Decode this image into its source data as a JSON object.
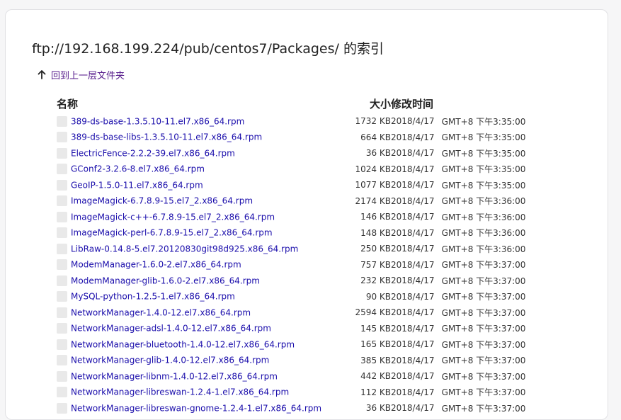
{
  "page": {
    "title": "ftp://192.168.199.224/pub/centos7/Packages/ 的索引",
    "up_label": "回到上一层文件夹"
  },
  "columns": {
    "name": "名称",
    "size": "大小",
    "modified": "修改时间"
  },
  "files": [
    {
      "name": "389-ds-base-1.3.5.10-11.el7.x86_64.rpm",
      "size": "1732 KB",
      "date": "2018/4/17",
      "time": "GMT+8 下午3:35:00"
    },
    {
      "name": "389-ds-base-libs-1.3.5.10-11.el7.x86_64.rpm",
      "size": "664 KB",
      "date": "2018/4/17",
      "time": "GMT+8 下午3:35:00"
    },
    {
      "name": "ElectricFence-2.2.2-39.el7.x86_64.rpm",
      "size": "36 KB",
      "date": "2018/4/17",
      "time": "GMT+8 下午3:35:00"
    },
    {
      "name": "GConf2-3.2.6-8.el7.x86_64.rpm",
      "size": "1024 KB",
      "date": "2018/4/17",
      "time": "GMT+8 下午3:35:00"
    },
    {
      "name": "GeoIP-1.5.0-11.el7.x86_64.rpm",
      "size": "1077 KB",
      "date": "2018/4/17",
      "time": "GMT+8 下午3:35:00"
    },
    {
      "name": "ImageMagick-6.7.8.9-15.el7_2.x86_64.rpm",
      "size": "2174 KB",
      "date": "2018/4/17",
      "time": "GMT+8 下午3:36:00"
    },
    {
      "name": "ImageMagick-c++-6.7.8.9-15.el7_2.x86_64.rpm",
      "size": "146 KB",
      "date": "2018/4/17",
      "time": "GMT+8 下午3:36:00"
    },
    {
      "name": "ImageMagick-perl-6.7.8.9-15.el7_2.x86_64.rpm",
      "size": "148 KB",
      "date": "2018/4/17",
      "time": "GMT+8 下午3:36:00"
    },
    {
      "name": "LibRaw-0.14.8-5.el7.20120830git98d925.x86_64.rpm",
      "size": "250 KB",
      "date": "2018/4/17",
      "time": "GMT+8 下午3:36:00"
    },
    {
      "name": "ModemManager-1.6.0-2.el7.x86_64.rpm",
      "size": "757 KB",
      "date": "2018/4/17",
      "time": "GMT+8 下午3:37:00"
    },
    {
      "name": "ModemManager-glib-1.6.0-2.el7.x86_64.rpm",
      "size": "232 KB",
      "date": "2018/4/17",
      "time": "GMT+8 下午3:37:00"
    },
    {
      "name": "MySQL-python-1.2.5-1.el7.x86_64.rpm",
      "size": "90 KB",
      "date": "2018/4/17",
      "time": "GMT+8 下午3:37:00"
    },
    {
      "name": "NetworkManager-1.4.0-12.el7.x86_64.rpm",
      "size": "2594 KB",
      "date": "2018/4/17",
      "time": "GMT+8 下午3:37:00"
    },
    {
      "name": "NetworkManager-adsl-1.4.0-12.el7.x86_64.rpm",
      "size": "145 KB",
      "date": "2018/4/17",
      "time": "GMT+8 下午3:37:00"
    },
    {
      "name": "NetworkManager-bluetooth-1.4.0-12.el7.x86_64.rpm",
      "size": "165 KB",
      "date": "2018/4/17",
      "time": "GMT+8 下午3:37:00"
    },
    {
      "name": "NetworkManager-glib-1.4.0-12.el7.x86_64.rpm",
      "size": "385 KB",
      "date": "2018/4/17",
      "time": "GMT+8 下午3:37:00"
    },
    {
      "name": "NetworkManager-libnm-1.4.0-12.el7.x86_64.rpm",
      "size": "442 KB",
      "date": "2018/4/17",
      "time": "GMT+8 下午3:37:00"
    },
    {
      "name": "NetworkManager-libreswan-1.2.4-1.el7.x86_64.rpm",
      "size": "112 KB",
      "date": "2018/4/17",
      "time": "GMT+8 下午3:37:00"
    },
    {
      "name": "NetworkManager-libreswan-gnome-1.2.4-1.el7.x86_64.rpm",
      "size": "36 KB",
      "date": "2018/4/17",
      "time": "GMT+8 下午3:37:00"
    }
  ]
}
